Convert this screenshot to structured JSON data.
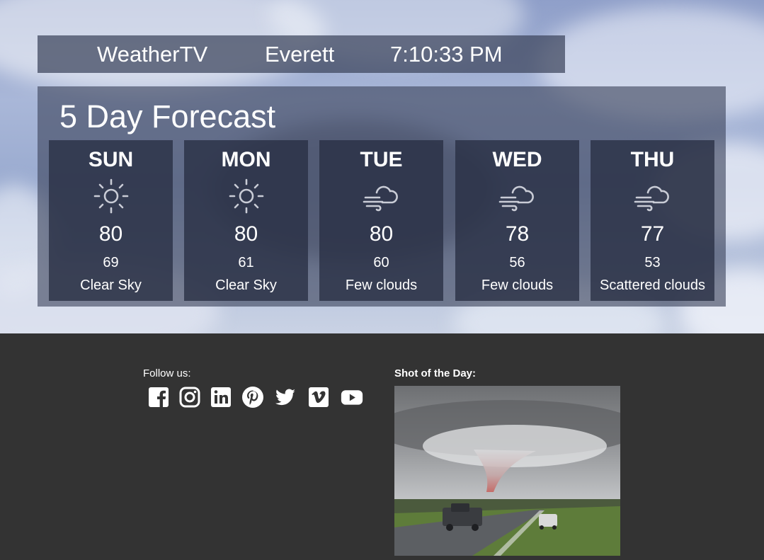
{
  "header": {
    "brand": "WeatherTV",
    "city": "Everett",
    "time": "7:10:33 PM"
  },
  "forecast": {
    "title": "5 Day Forecast",
    "days": [
      {
        "name": "SUN",
        "icon": "sun-icon",
        "high": "80",
        "low": "69",
        "description": "Clear Sky"
      },
      {
        "name": "MON",
        "icon": "sun-icon",
        "high": "80",
        "low": "61",
        "description": "Clear Sky"
      },
      {
        "name": "TUE",
        "icon": "cloud-wind-icon",
        "high": "80",
        "low": "60",
        "description": "Few clouds"
      },
      {
        "name": "WED",
        "icon": "cloud-wind-icon",
        "high": "78",
        "low": "56",
        "description": "Few clouds"
      },
      {
        "name": "THU",
        "icon": "cloud-wind-icon",
        "high": "77",
        "low": "53",
        "description": "Scattered clouds"
      }
    ]
  },
  "footer": {
    "follow_label": "Follow us:",
    "social": [
      "facebook-icon",
      "instagram-icon",
      "linkedin-icon",
      "pinterest-icon",
      "twitter-icon",
      "vimeo-icon",
      "youtube-icon"
    ],
    "shot_label": "Shot of the Day:"
  },
  "colors": {
    "header_bg": "#3c445c",
    "card_bg": "#282e42",
    "footer_bg": "#333333",
    "text": "#ffffff"
  }
}
